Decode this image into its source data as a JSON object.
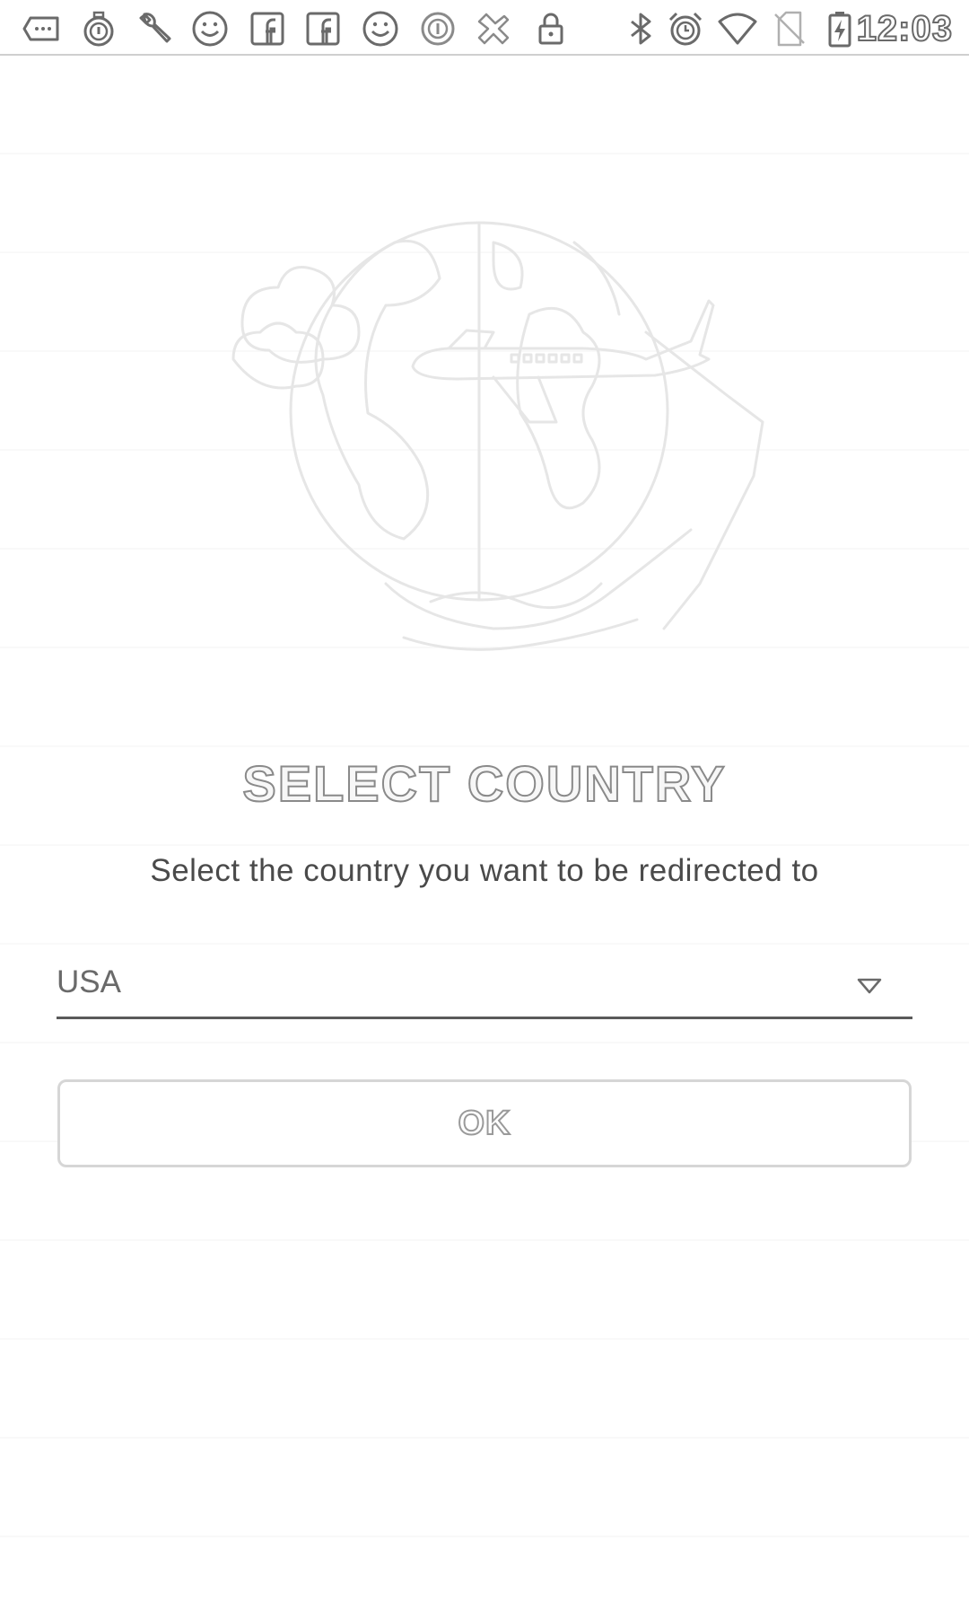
{
  "status_bar": {
    "time": "12:03",
    "icons": [
      "message-icon",
      "stopwatch-icon",
      "wrench-icon",
      "smiley-icon",
      "facebook-icon",
      "facebook-icon",
      "smiley-icon",
      "app-icon",
      "fav-icon",
      "lock-icon",
      "bluetooth-icon",
      "alarm-icon",
      "wifi-icon",
      "no-sim-icon",
      "battery-charging-icon"
    ]
  },
  "screen": {
    "title": "SELECT COUNTRY",
    "subtitle": "Select the country you want to be redirected to",
    "country_select": {
      "selected": "USA"
    },
    "ok_button": {
      "label": "OK"
    }
  },
  "colors": {
    "background": "#ffffff",
    "text": "#4a4a4a",
    "underline": "#5a5a5a",
    "button_border": "#d6d6d6"
  }
}
